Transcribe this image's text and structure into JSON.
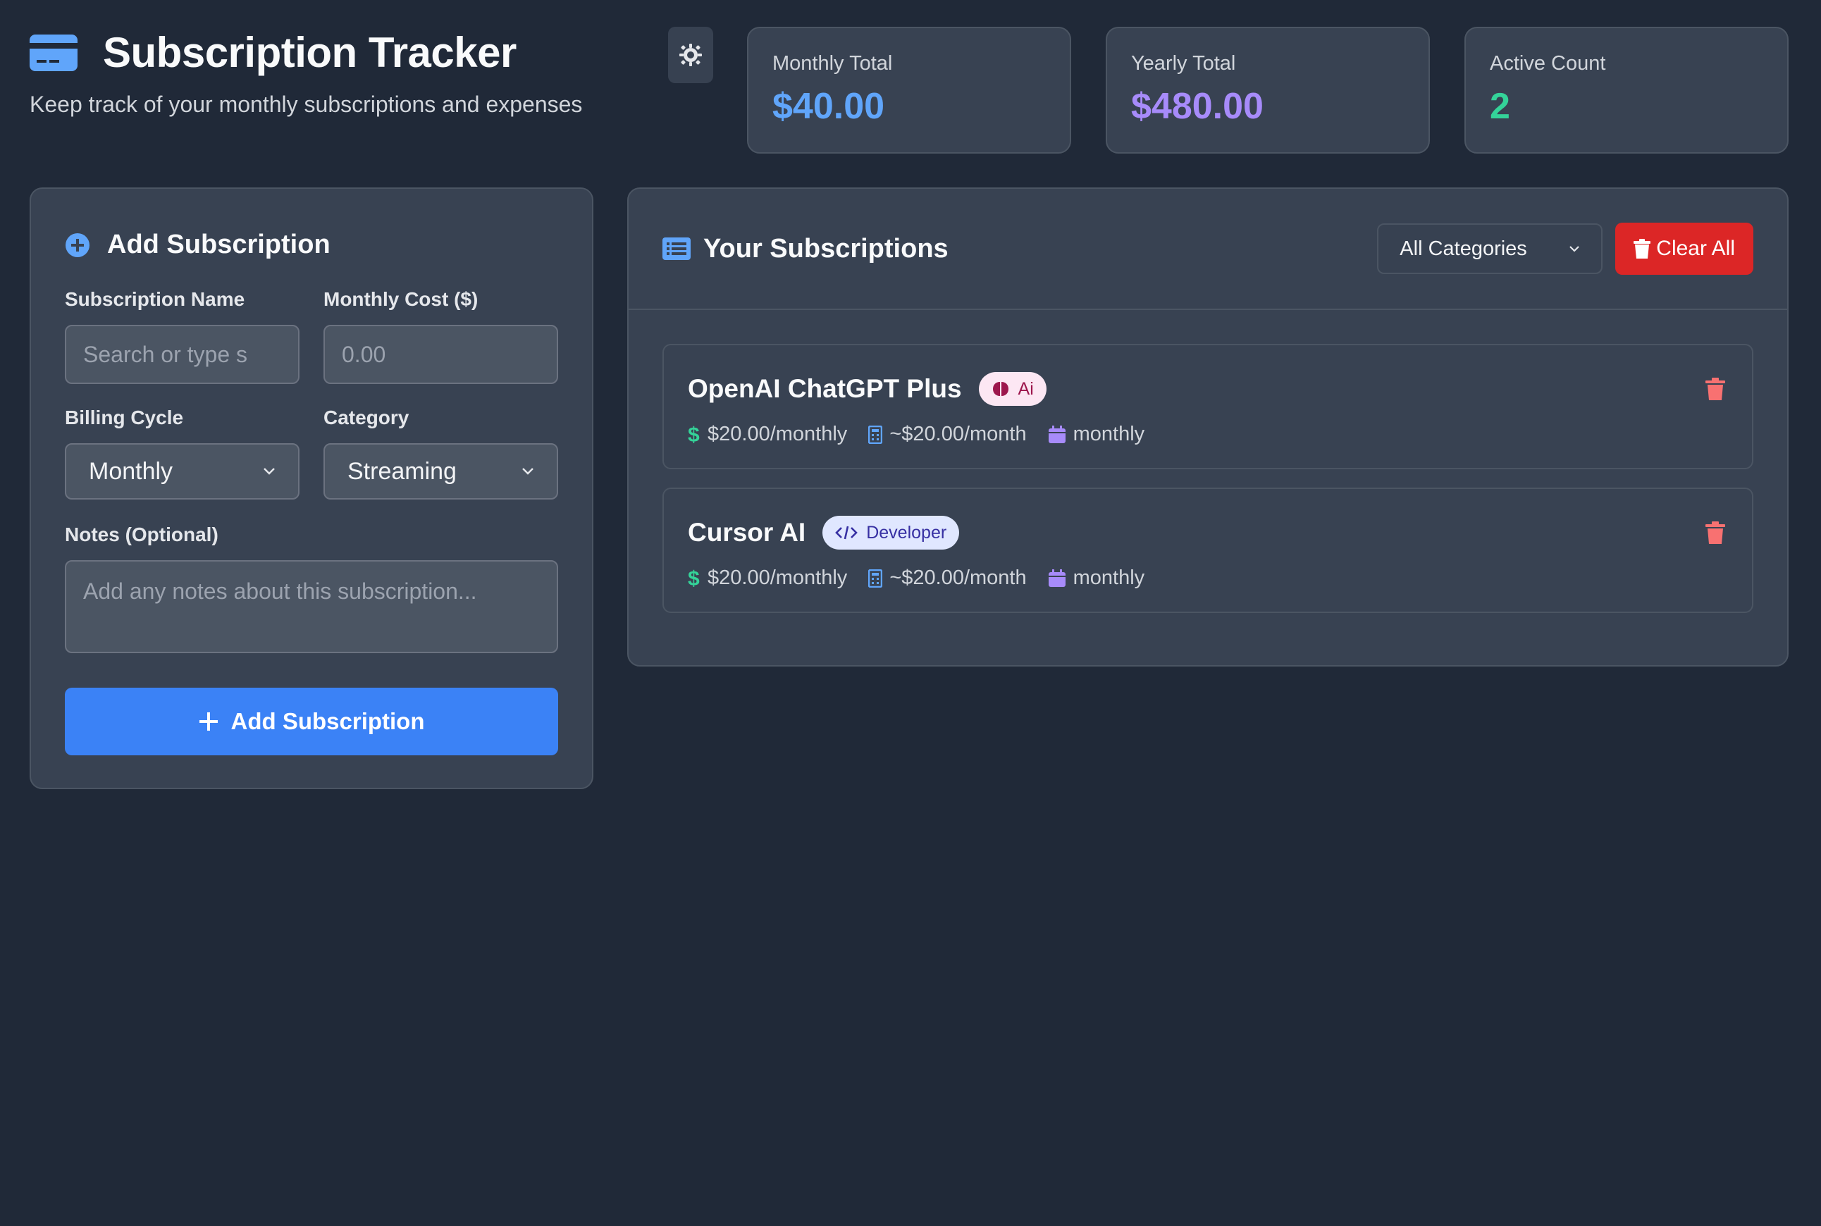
{
  "header": {
    "title": "Subscription Tracker",
    "subtitle": "Keep track of your monthly subscriptions and expenses"
  },
  "stats": [
    {
      "label": "Monthly Total",
      "value": "$40.00",
      "color": "#60a5fa"
    },
    {
      "label": "Yearly Total",
      "value": "$480.00",
      "color": "#a78bfa"
    },
    {
      "label": "Active Count",
      "value": "2",
      "color": "#34d399"
    }
  ],
  "add_form": {
    "title": "Add Subscription",
    "name_label": "Subscription Name",
    "name_placeholder": "Search or type s",
    "cost_label": "Monthly Cost ($)",
    "cost_placeholder": "0.00",
    "billing_label": "Billing Cycle",
    "billing_value": "Monthly",
    "category_label": "Category",
    "category_value": "Streaming",
    "notes_label": "Notes (Optional)",
    "notes_placeholder": "Add any notes about this subscription...",
    "submit_label": "Add Subscription"
  },
  "list": {
    "title": "Your Subscriptions",
    "filter_value": "All Categories",
    "clear_label": "Clear All",
    "items": [
      {
        "name": "OpenAI ChatGPT Plus",
        "badge": "Ai",
        "badge_icon": "brain-icon",
        "price": "$20.00/monthly",
        "monthly": "~$20.00/month",
        "cycle": "monthly"
      },
      {
        "name": "Cursor AI",
        "badge": "Developer",
        "badge_icon": "code-icon",
        "price": "$20.00/monthly",
        "monthly": "~$20.00/month",
        "cycle": "monthly"
      }
    ]
  },
  "colors": {
    "background": "#202938",
    "panel": "#384252",
    "accent": "#3b82f6",
    "danger": "#dc2626"
  }
}
